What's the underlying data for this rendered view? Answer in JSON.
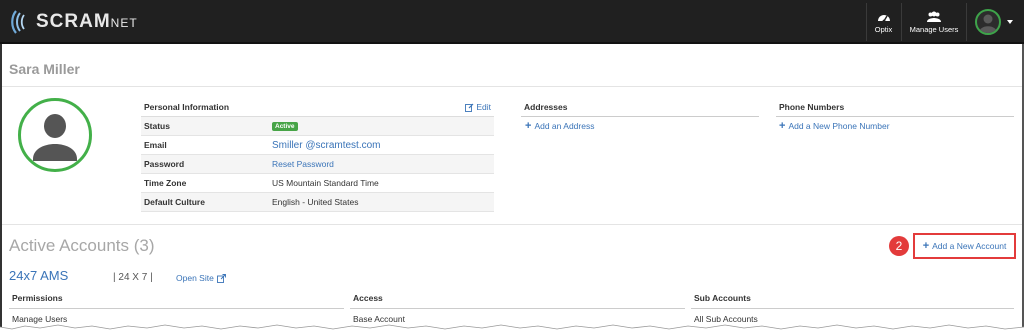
{
  "brand": {
    "scram": "SCRAM",
    "net": "NET"
  },
  "nav": {
    "optix_label": "Optix",
    "manage_users_label": "Manage Users"
  },
  "user": {
    "name": "Sara Miller"
  },
  "personal_info": {
    "title": "Personal Information",
    "edit_label": "Edit",
    "rows": [
      {
        "label": "Status",
        "value": "Active"
      },
      {
        "label": "Email",
        "value": "Smiller @scramtest.com"
      },
      {
        "label": "Password",
        "value": "Reset Password"
      },
      {
        "label": "Time Zone",
        "value": "US Mountain Standard Time"
      },
      {
        "label": "Default Culture",
        "value": "English - United States"
      }
    ]
  },
  "addresses": {
    "title": "Addresses",
    "add_label": "Add an Address"
  },
  "phones": {
    "title": "Phone Numbers",
    "add_label": "Add a New Phone Number"
  },
  "accounts": {
    "title": "Active Accounts (3)",
    "callout_number": "2",
    "add_label": "Add a New Account",
    "first": {
      "name": "24x7 AMS",
      "type": "| 24 X 7 |",
      "open_site_label": "Open Site",
      "columns": [
        "Permissions",
        "Access",
        "Sub Accounts"
      ],
      "cells": [
        "Manage Users",
        "Base Account",
        "All Sub Accounts"
      ]
    }
  },
  "colors": {
    "link": "#3a74b8",
    "accent_green": "#43b049",
    "callout_red": "#e33b3b",
    "topbar": "#202020"
  },
  "icons": [
    "scram-logo-icon",
    "optix-dashboard-icon",
    "users-icon",
    "avatar-icon",
    "edit-icon",
    "plus-icon",
    "external-link-icon"
  ]
}
